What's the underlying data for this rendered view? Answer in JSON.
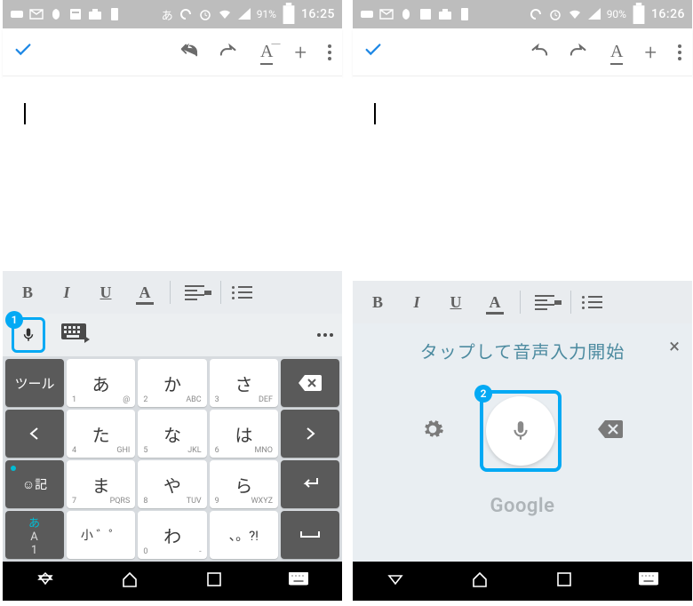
{
  "left": {
    "status": {
      "battery": "91%",
      "time": "16:25",
      "mode": "あ"
    },
    "toolbar": {
      "check": "✓",
      "redo_underline": "A"
    },
    "fmt": {
      "b": "B",
      "i": "I",
      "u": "U",
      "a": "A"
    },
    "callout": "1",
    "keys": {
      "tool": "ツール",
      "r1": {
        "a": "あ",
        "ka": "か",
        "sa": "さ"
      },
      "subs": {
        "a_l": "1",
        "a_r": "@",
        "ka_l": "2",
        "ka_r": "ABC",
        "sa_l": "3",
        "sa_r": "DEF"
      },
      "r2": {
        "ta": "た",
        "na": "な",
        "ha": "は"
      },
      "subs2": {
        "ta_l": "4",
        "ta_r": "GHI",
        "na_l": "5",
        "na_r": "JKL",
        "ha_l": "6",
        "ha_r": "MNO"
      },
      "emoji": "☺記",
      "r3": {
        "ma": "ま",
        "ya": "や",
        "ra": "ら"
      },
      "subs3": {
        "ma_l": "7",
        "ma_r": "PQRS",
        "ya_l": "8",
        "ya_r": "TUV",
        "ra_l": "9",
        "ra_r": "WXYZ"
      },
      "mode_a": "あ",
      "mode_k": "A",
      "mode_n": "1",
      "r4": {
        "small": "小 ゛゜",
        "wa": "わ",
        "punct": "、。?!"
      },
      "subs4": {
        "wa_l": "0",
        "wa_r": "-"
      },
      "space": "␣"
    }
  },
  "right": {
    "status": {
      "battery": "90%",
      "time": "16:26"
    },
    "fmt": {
      "b": "B",
      "i": "I",
      "u": "U",
      "a": "A"
    },
    "voice": {
      "title": "タップして音声入力開始",
      "callout": "2",
      "brand": "Google",
      "close": "×"
    }
  }
}
